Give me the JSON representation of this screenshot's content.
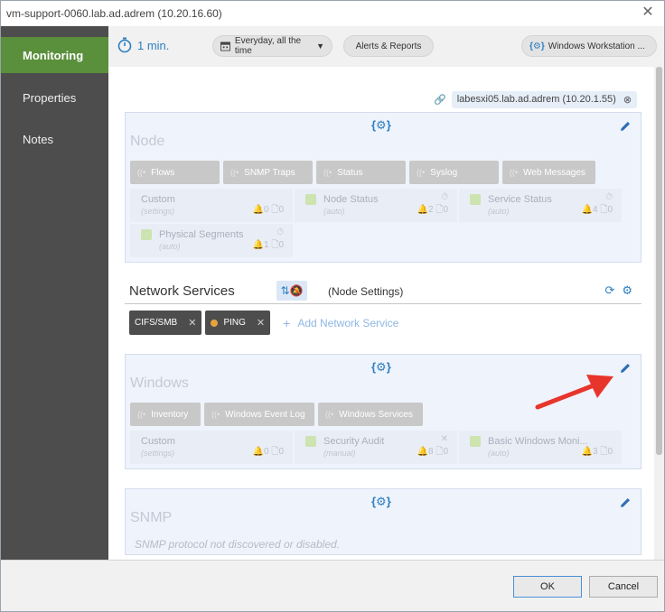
{
  "window": {
    "title": "vm-support-0060.lab.ad.adrem (10.20.16.60)"
  },
  "sidebar": {
    "items": [
      {
        "label": "Monitoring",
        "active": true
      },
      {
        "label": "Properties"
      },
      {
        "label": "Notes"
      }
    ]
  },
  "toolbar": {
    "interval": "1 min.",
    "schedule": "Everyday, all the time",
    "alerts": "Alerts & Reports",
    "template": "Windows Workstation ..."
  },
  "host": {
    "label": "labesxi05.lab.ad.adrem (10.20.1.55)"
  },
  "node_panel": {
    "title": "Node",
    "buttons": [
      "Flows",
      "SNMP Traps",
      "Status",
      "Syslog",
      "Web Messages"
    ],
    "cards": [
      {
        "name": "Custom",
        "sub": "(settings)",
        "alerts": "0",
        "docs": "0",
        "cube": false
      },
      {
        "name": "Node Status",
        "sub": "(auto)",
        "alerts": "2",
        "docs": "0",
        "cube": true
      },
      {
        "name": "Service Status",
        "sub": "(auto)",
        "alerts": "4",
        "docs": "0",
        "cube": true
      },
      {
        "name": "Physical Segments",
        "sub": "(auto)",
        "alerts": "1",
        "docs": "0",
        "cube": true
      }
    ]
  },
  "network_services": {
    "title": "Network Services",
    "node_settings": "(Node Settings)",
    "items": [
      {
        "label": "CIFS/SMB",
        "dot": false
      },
      {
        "label": "PING",
        "dot": true
      }
    ],
    "add_label": "Add Network Service"
  },
  "windows_panel": {
    "title": "Windows",
    "buttons": [
      "Inventory",
      "Windows Event Log",
      "Windows Services"
    ],
    "cards": [
      {
        "name": "Custom",
        "sub": "(settings)",
        "alerts": "0",
        "docs": "0",
        "cube": false
      },
      {
        "name": "Security Audit",
        "sub": "(manual)",
        "alerts": "8",
        "docs": "0",
        "cube": true
      },
      {
        "name": "Basic Windows Moni...",
        "sub": "(auto)",
        "alerts": "3",
        "docs": "0",
        "cube": true
      }
    ]
  },
  "snmp_panel": {
    "title": "SNMP",
    "message": "SNMP protocol not discovered or disabled."
  },
  "footer": {
    "ok": "OK",
    "cancel": "Cancel"
  },
  "colors": {
    "accent": "#2d7fc1",
    "active_nav": "#5a8f3c",
    "arrow": "#e8352c",
    "sidebar": "#4d4d4d"
  }
}
